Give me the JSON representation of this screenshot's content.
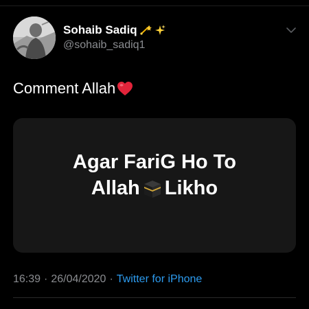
{
  "author": {
    "display_name": "Sohaib Sadiq",
    "handle": "@sohaib_sadiq1",
    "name_emojis": [
      "dizzy-emoji",
      "sparkles-emoji"
    ]
  },
  "tweet": {
    "text": "Comment Allah",
    "text_emoji": "red-heart-emoji"
  },
  "media": {
    "line1": "Agar FariG Ho To",
    "line2_before": "Allah",
    "line2_emoji": "kaaba-emoji",
    "line2_after": "Likho"
  },
  "meta": {
    "time": "16:39",
    "date": "26/04/2020",
    "separator": "·",
    "source": "Twitter for iPhone"
  },
  "colors": {
    "background": "#000000",
    "primary_text": "#ffffff",
    "secondary_text": "#8b8d91",
    "link": "#2d9cf0",
    "card": "#171717"
  }
}
